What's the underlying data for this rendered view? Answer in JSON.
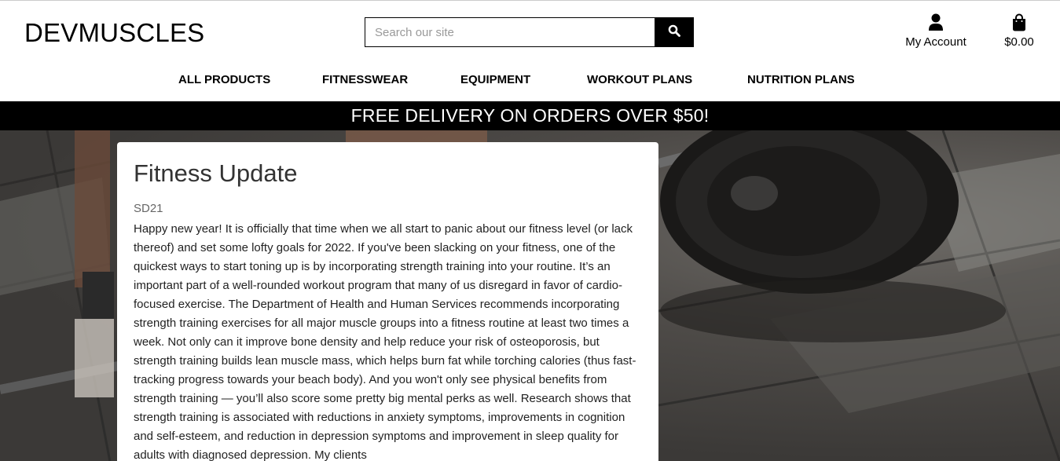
{
  "header": {
    "logo": "DEVMUSCLES",
    "search": {
      "placeholder": "Search our site",
      "value": ""
    },
    "account_label": "My Account",
    "bag_total": "$0.00",
    "icons": {
      "search": "search-icon",
      "account": "user-icon",
      "bag": "shopping-bag-icon"
    }
  },
  "nav": {
    "items": [
      {
        "label": "ALL PRODUCTS"
      },
      {
        "label": "FITNESSWEAR"
      },
      {
        "label": "EQUIPMENT"
      },
      {
        "label": "WORKOUT PLANS"
      },
      {
        "label": "NUTRITION PLANS"
      }
    ]
  },
  "banner": {
    "text": "FREE DELIVERY ON ORDERS OVER $50!"
  },
  "post": {
    "title": "Fitness Update",
    "author": "SD21",
    "body": "Happy new year! It is officially that time when we all start to panic about our fitness level (or lack thereof) and set some lofty goals for 2022. If you've been slacking on your fitness, one of the quickest ways to start toning up is by incorporating strength training into your routine. It’s an important part of a well-rounded workout program that many of us disregard in favor of cardio-focused exercise. The Department of Health and Human Services recommends incorporating strength training exercises for all major muscle groups into a fitness routine at least two times a week. Not only can it improve bone density and help reduce your risk of osteoporosis, but strength training builds lean muscle mass, which helps burn fat while torching calories (thus fast-tracking progress towards your beach body). And you won't only see physical benefits from strength training — you’ll also score some pretty big mental perks as well. Research shows that strength training is associated with reductions in anxiety symptoms, improvements in cognition and self-esteem, and reduction in depression symptoms and improvement in sleep quality for adults with diagnosed depression. My clients"
  },
  "colors": {
    "banner_bg": "#000000",
    "text": "#000000",
    "card_bg": "#ffffff"
  }
}
